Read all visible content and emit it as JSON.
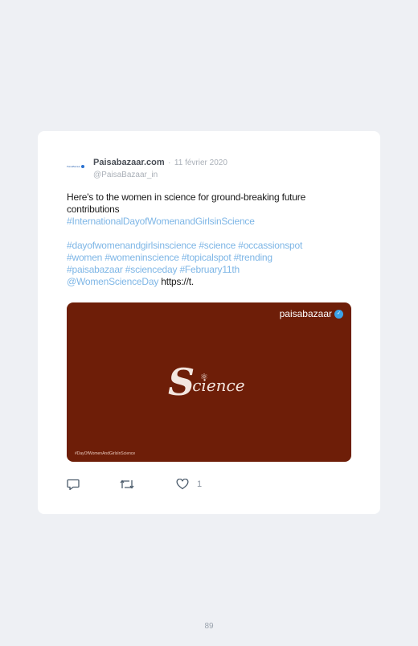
{
  "tweet": {
    "avatar_text": "PaisaBazaar",
    "name": "Paisabazaar.com",
    "separator": "·",
    "date": "11 février 2020",
    "handle": "@PaisaBazaar_in",
    "text_line1": "Here's to the women in science for ground-breaking future contributions",
    "tag_1": "#InternationalDayofWomenandGirlsinScience",
    "line2_tags": [
      "#dayofwomenandgirlsinscience",
      "#science",
      "#occassionspot"
    ],
    "line3_tags": [
      "#women",
      "#womeninscience",
      "#topicalspot",
      "#trending"
    ],
    "line4_tags": [
      "#paisabazaar",
      "#scienceday",
      "#February11th"
    ],
    "mention": "@WomenScienceDay",
    "link": "https://t."
  },
  "media": {
    "brand": "paisabazaar",
    "brand_badge": "✓",
    "science_initial": "S",
    "science_rest": "cience",
    "atom": "⚛",
    "caption": "#DayOfWomenAndGirlsInScience",
    "background_color": "#6e1e08"
  },
  "actions": {
    "reply_icon": "reply-icon",
    "retweet_icon": "retweet-icon",
    "like_icon": "like-icon",
    "like_count": "1"
  },
  "page": {
    "number": "89"
  }
}
